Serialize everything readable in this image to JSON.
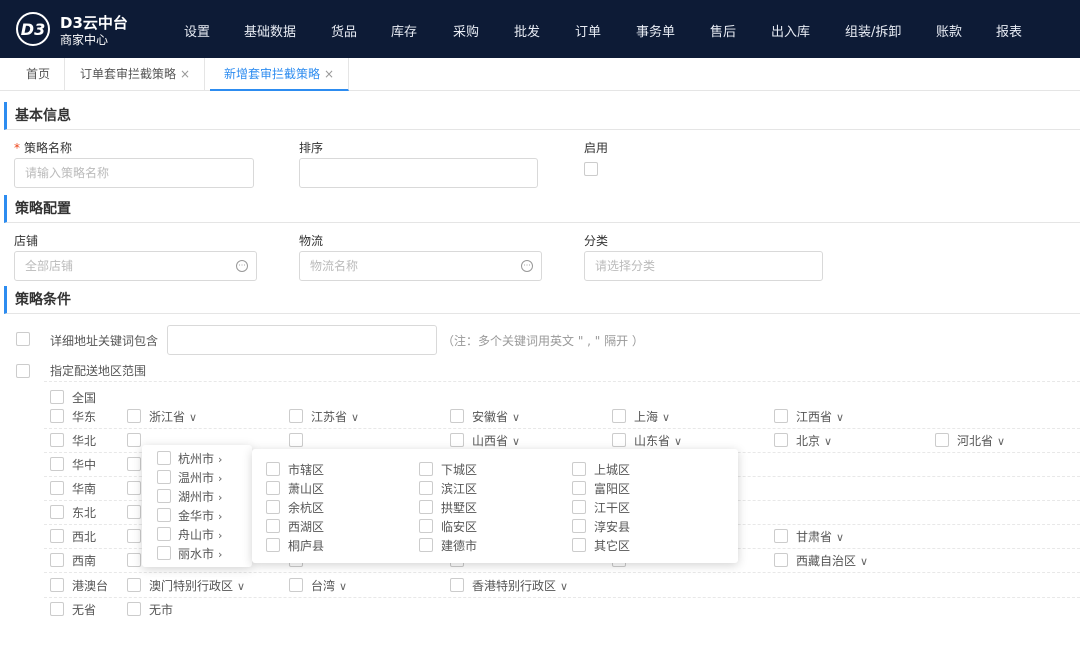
{
  "header": {
    "logo_text": "D3",
    "brand_title": "D3云中台",
    "brand_subtitle": "商家中心",
    "nav": [
      "设置",
      "基础数据",
      "货品",
      "库存",
      "采购",
      "批发",
      "订单",
      "事务单",
      "售后",
      "出入库",
      "组装/拆卸",
      "账款",
      "报表"
    ]
  },
  "tabs": [
    {
      "label": "首页",
      "closable": false
    },
    {
      "label": "订单套审拦截策略",
      "closable": true
    },
    {
      "label": "新增套审拦截策略",
      "closable": true,
      "active": true
    }
  ],
  "tab_close_glyph": "×",
  "basic": {
    "section_title": "基本信息",
    "name_required_mark": "*",
    "name_label": "策略名称",
    "name_placeholder": "请输入策略名称",
    "sort_label": "排序",
    "enable_label": "启用"
  },
  "config": {
    "section_title": "策略配置",
    "shop_label": "店铺",
    "shop_placeholder": "全部店铺",
    "logistics_label": "物流",
    "logistics_placeholder": "物流名称",
    "category_label": "分类",
    "category_placeholder": "请选择分类"
  },
  "conditions": {
    "section_title": "策略条件",
    "keyword_label": "详细地址关键词包含",
    "keyword_hint": "（注：多个关键词用英文 \" , \" 隔开 ）",
    "region_label": "指定配送地区范围",
    "all_label": "全国"
  },
  "regions": [
    {
      "name": "华东",
      "provinces": [
        "浙江省",
        "江苏省",
        "安徽省",
        "上海",
        "江西省"
      ]
    },
    {
      "name": "华北",
      "provinces": [
        "",
        "",
        "山西省",
        "山东省",
        "北京",
        "河北省"
      ]
    },
    {
      "name": "华中",
      "provinces": []
    },
    {
      "name": "华南",
      "provinces": []
    },
    {
      "name": "东北",
      "provinces": []
    },
    {
      "name": "西北",
      "provinces": [
        "",
        "",
        "",
        "",
        "甘肃省"
      ]
    },
    {
      "name": "西南",
      "provinces": [
        "",
        "",
        "",
        "",
        "西藏自治区"
      ]
    },
    {
      "name": "港澳台",
      "provinces": [
        "澳门特别行政区",
        "台湾",
        "香港特别行政区"
      ]
    },
    {
      "name": "无省",
      "provinces": [
        "无市"
      ]
    }
  ],
  "city_popup": {
    "cities": [
      "杭州市",
      "温州市",
      "湖州市",
      "金华市",
      "舟山市",
      "丽水市"
    ],
    "districts": [
      "市辖区",
      "下城区",
      "上城区",
      "萧山区",
      "滨江区",
      "富阳区",
      "余杭区",
      "拱墅区",
      "江干区",
      "西湖区",
      "临安区",
      "淳安县",
      "桐庐县",
      "建德市",
      "其它区"
    ]
  },
  "colors": {
    "header_bg": "#0d1b36",
    "accent": "#2d8cf0",
    "required": "#ed4014"
  },
  "icons": {
    "logo": "d3-logo-icon",
    "chevron": "chevron-down-icon",
    "chevron_right": "chevron-right-icon",
    "more": "ellipsis-circle-icon"
  }
}
